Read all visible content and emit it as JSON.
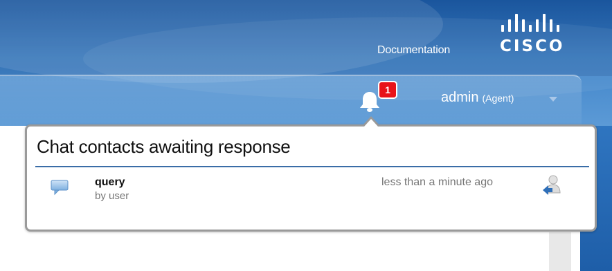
{
  "header": {
    "documentation_link": "Documentation",
    "logo_text": "CISCO",
    "notifications": {
      "icon": "bell-icon",
      "count": "1"
    },
    "user": {
      "name": "admin",
      "role": "(Agent)"
    }
  },
  "popup": {
    "title": "Chat contacts awaiting response",
    "contacts": [
      {
        "name": "query",
        "by": "by user",
        "time": "less than a minute ago",
        "icon": "chat-bubble-icon",
        "action_icon": "accept-contact-icon"
      }
    ]
  },
  "colors": {
    "header_blue": "#3f84c9",
    "badge_red": "#e8131a",
    "divider_blue": "#3a6da7"
  }
}
